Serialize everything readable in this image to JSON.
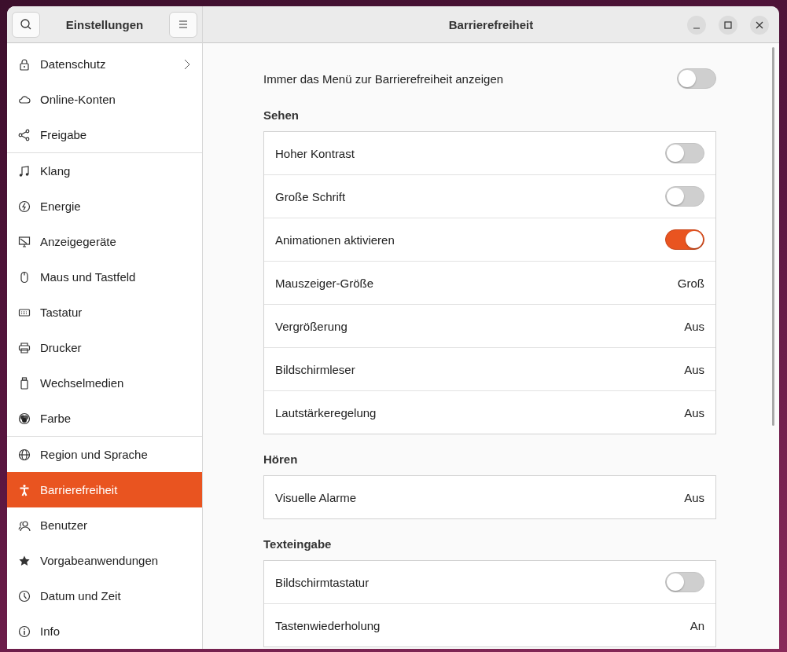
{
  "sidebar": {
    "title": "Einstellungen",
    "groups": [
      [
        {
          "label": "Datenschutz",
          "kind": "lock",
          "selected": false,
          "has_submenu": true
        },
        {
          "label": "Online-Konten",
          "kind": "cloud",
          "selected": false
        },
        {
          "label": "Freigabe",
          "kind": "share",
          "selected": false
        }
      ],
      [
        {
          "label": "Klang",
          "kind": "music",
          "selected": false
        },
        {
          "label": "Energie",
          "kind": "power",
          "selected": false
        },
        {
          "label": "Anzeigegeräte",
          "kind": "display",
          "selected": false
        },
        {
          "label": "Maus und Tastfeld",
          "kind": "mouse",
          "selected": false
        },
        {
          "label": "Tastatur",
          "kind": "keyboard",
          "selected": false
        },
        {
          "label": "Drucker",
          "kind": "printer",
          "selected": false
        },
        {
          "label": "Wechselmedien",
          "kind": "usb",
          "selected": false
        },
        {
          "label": "Farbe",
          "kind": "color",
          "selected": false
        }
      ],
      [
        {
          "label": "Region und Sprache",
          "kind": "globe",
          "selected": false
        },
        {
          "label": "Barrierefreiheit",
          "kind": "accessibility",
          "selected": true
        },
        {
          "label": "Benutzer",
          "kind": "users",
          "selected": false
        },
        {
          "label": "Vorgabeanwendungen",
          "kind": "star",
          "selected": false
        },
        {
          "label": "Datum und Zeit",
          "kind": "clock",
          "selected": false
        },
        {
          "label": "Info",
          "kind": "info",
          "selected": false
        }
      ]
    ]
  },
  "window": {
    "title": "Barrierefreiheit"
  },
  "top_option": {
    "label": "Immer das Menü zur Barrierefreiheit anzeigen",
    "on": false
  },
  "sections": [
    {
      "heading": "Sehen",
      "rows": [
        {
          "label": "Hoher Kontrast",
          "kind": "switch",
          "on": false
        },
        {
          "label": "Große Schrift",
          "kind": "switch",
          "on": false
        },
        {
          "label": "Animationen aktivieren",
          "kind": "switch",
          "on": true
        },
        {
          "label": "Mauszeiger-Größe",
          "kind": "value",
          "value": "Groß"
        },
        {
          "label": "Vergrößerung",
          "kind": "value",
          "value": "Aus"
        },
        {
          "label": "Bildschirmleser",
          "kind": "value",
          "value": "Aus"
        },
        {
          "label": "Lautstärkeregelung",
          "kind": "value",
          "value": "Aus"
        }
      ]
    },
    {
      "heading": "Hören",
      "rows": [
        {
          "label": "Visuelle Alarme",
          "kind": "value",
          "value": "Aus"
        }
      ]
    },
    {
      "heading": "Texteingabe",
      "rows": [
        {
          "label": "Bildschirmtastatur",
          "kind": "switch",
          "on": false
        },
        {
          "label": "Tastenwiederholung",
          "kind": "value",
          "value": "An"
        }
      ]
    }
  ]
}
